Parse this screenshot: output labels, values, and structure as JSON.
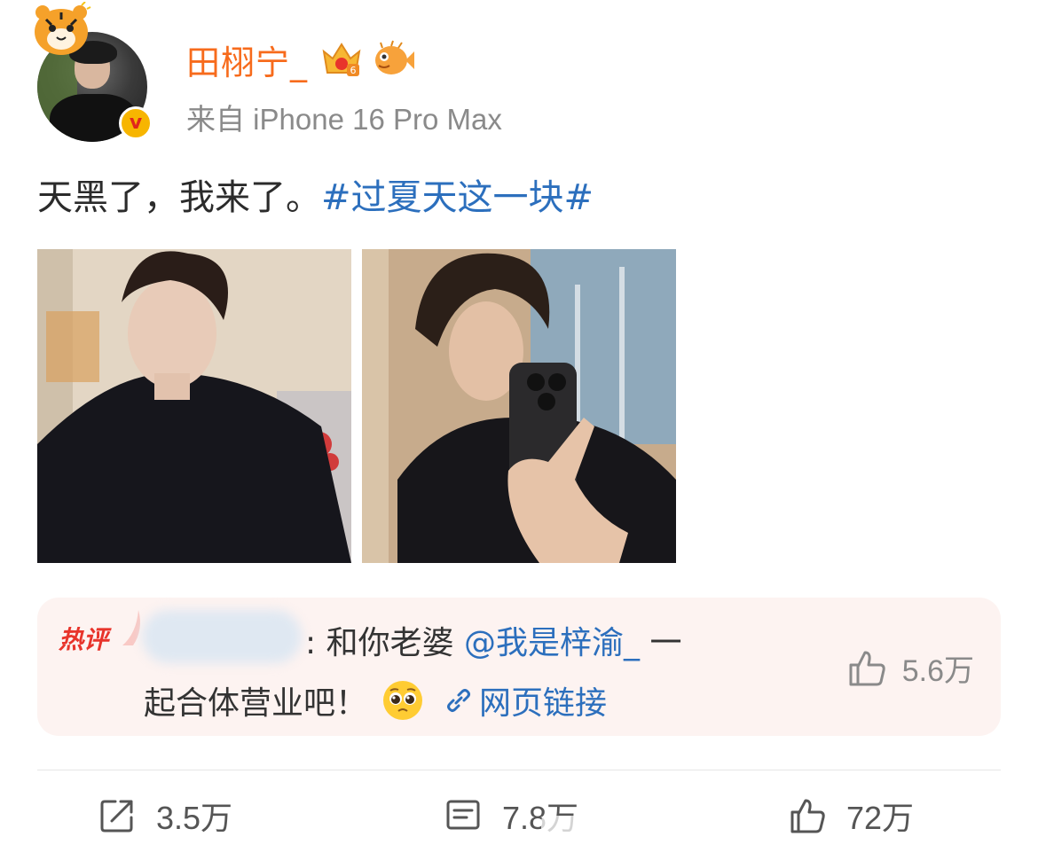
{
  "user": {
    "name": "田栩宁_",
    "source": "来自 iPhone 16 Pro Max"
  },
  "post": {
    "text": "天黑了，我来了。",
    "hashtag": "#过夏天这一块#"
  },
  "hot_comment": {
    "label": "热评",
    "prefix": ": 和你老婆 ",
    "mention": "@我是梓渝_",
    "line1_suffix": " 一",
    "line2": "起合体营业吧！",
    "link_label": "网页链接",
    "like_count": "5.6万"
  },
  "actions": {
    "share_count": "3.5万",
    "comment_count": "7.8万",
    "like_count": "72万"
  },
  "colors": {
    "username": "#f76b1c",
    "link": "#2c6fbd",
    "hot_label": "#e8342b",
    "muted": "#8a8a8a"
  },
  "icons": [
    "tiger-sticker-icon",
    "crown-badge-icon",
    "pufferfish-badge-icon",
    "verified-icon",
    "link-icon",
    "pleading-face-emoji",
    "thumb-up-icon",
    "share-icon",
    "comment-icon"
  ]
}
